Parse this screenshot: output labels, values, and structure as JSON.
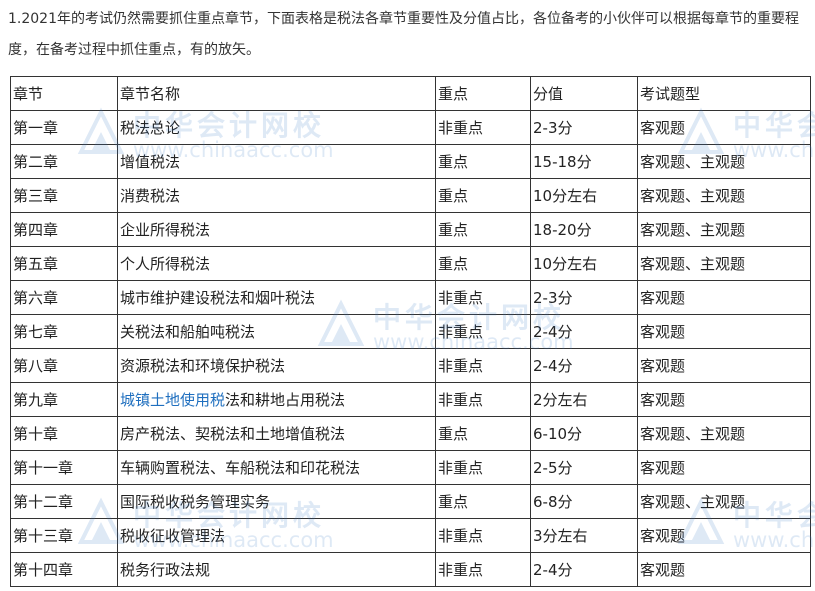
{
  "intro": "1.2021年的考试仍然需要抓住重点章节，下面表格是税法各章节重要性及分值占比，各位备考的小伙伴可以根据每章节的重要程度，在备考过程中抓住重点，有的放矢。",
  "watermark": {
    "name": "中华会计网校",
    "url": "www.chinaacc.com"
  },
  "table": {
    "headers": [
      "章节",
      "章节名称",
      "重点",
      "分值",
      "考试题型"
    ],
    "rows": [
      {
        "chapter": "第一章",
        "name": "税法总论",
        "key": "非重点",
        "score": "2-3分",
        "type": "客观题"
      },
      {
        "chapter": "第二章",
        "name": "增值税法",
        "key": "重点",
        "score": "15-18分",
        "type": "客观题、主观题"
      },
      {
        "chapter": "第三章",
        "name": "消费税法",
        "key": "重点",
        "score": "10分左右",
        "type": "客观题、主观题"
      },
      {
        "chapter": "第四章",
        "name": "企业所得税法",
        "key": "重点",
        "score": "18-20分",
        "type": "客观题、主观题"
      },
      {
        "chapter": "第五章",
        "name": "个人所得税法",
        "key": "重点",
        "score": "10分左右",
        "type": "客观题、主观题"
      },
      {
        "chapter": "第六章",
        "name": "城市维护建设税法和烟叶税法",
        "key": "非重点",
        "score": "2-3分",
        "type": "客观题"
      },
      {
        "chapter": "第七章",
        "name": "关税法和船舶吨税法",
        "key": "非重点",
        "score": "2-4分",
        "type": "客观题"
      },
      {
        "chapter": "第八章",
        "name": "资源税法和环境保护税法",
        "key": "非重点",
        "score": "2-4分",
        "type": "客观题"
      },
      {
        "chapter": "第九章",
        "name_link": "城镇土地使用税",
        "name_rest": "法和耕地占用税法",
        "key": "非重点",
        "score": "2分左右",
        "type": "客观题"
      },
      {
        "chapter": "第十章",
        "name": "房产税法、契税法和土地增值税法",
        "key": "重点",
        "score": "6-10分",
        "type": "客观题、主观题"
      },
      {
        "chapter": "第十一章",
        "name": "车辆购置税法、车船税法和印花税法",
        "key": "非重点",
        "score": "2-5分",
        "type": "客观题"
      },
      {
        "chapter": "第十二章",
        "name": "国际税收税务管理实务",
        "key": "重点",
        "score": "6-8分",
        "type": "客观题、主观题"
      },
      {
        "chapter": "第十三章",
        "name": "税收征收管理法",
        "key": "非重点",
        "score": "3分左右",
        "type": "客观题"
      },
      {
        "chapter": "第十四章",
        "name": "税务行政法规",
        "key": "非重点",
        "score": "2-4分",
        "type": "客观题"
      }
    ]
  }
}
